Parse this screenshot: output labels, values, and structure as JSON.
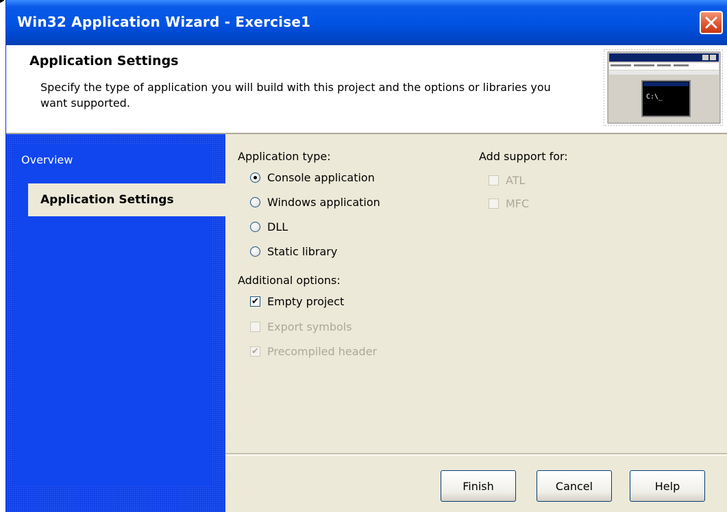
{
  "window": {
    "title": "Win32 Application Wizard - Exercise1"
  },
  "header": {
    "title": "Application Settings",
    "description": "Specify the type of application you will build with this project and the options or libraries you want supported."
  },
  "sidebar": {
    "items": [
      {
        "label": "Overview",
        "active": false
      },
      {
        "label": "Application Settings",
        "active": true
      }
    ]
  },
  "application_type": {
    "label": "Application type:",
    "options": [
      {
        "label": "Console application",
        "checked": true
      },
      {
        "label": "Windows application",
        "checked": false
      },
      {
        "label": "DLL",
        "checked": false
      },
      {
        "label": "Static library",
        "checked": false
      }
    ]
  },
  "additional_options": {
    "label": "Additional options:",
    "options": [
      {
        "label": "Empty project",
        "checked": true,
        "enabled": true
      },
      {
        "label": "Export symbols",
        "checked": false,
        "enabled": false
      },
      {
        "label": "Precompiled header",
        "checked": true,
        "enabled": false
      }
    ]
  },
  "add_support": {
    "label": "Add support for:",
    "options": [
      {
        "label": "ATL",
        "checked": false,
        "enabled": false
      },
      {
        "label": "MFC",
        "checked": false,
        "enabled": false
      }
    ]
  },
  "buttons": {
    "finish": "Finish",
    "cancel": "Cancel",
    "help": "Help"
  },
  "preview_prompt": "C:\\_",
  "colors": {
    "titlebar": "#0054e3",
    "sidebar": "#0d3ee8",
    "dialog_bg": "#ece9d8",
    "close_button": "#e0512c"
  }
}
